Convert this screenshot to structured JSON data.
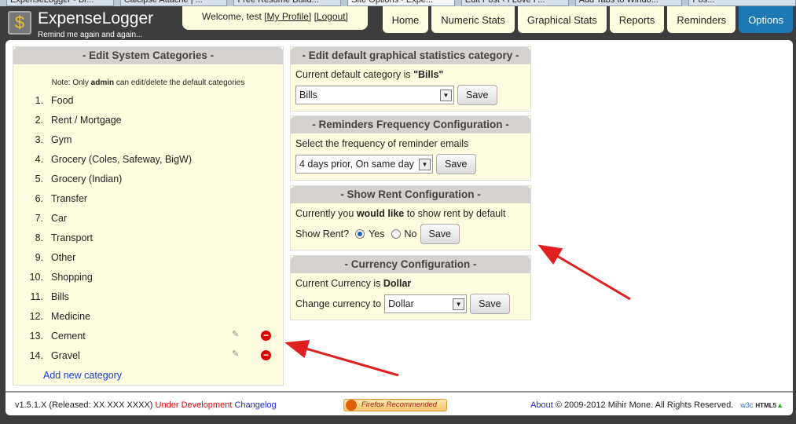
{
  "browser_tabs": [
    "ExpenseLogger - Br...",
    "Calcipse Attache | ...",
    "Free Resume Build...",
    "Site Options - Expe...",
    "Edit Post ‹ I Love F...",
    "Add Tabs to Windo...",
    "Pos..."
  ],
  "header": {
    "title": "ExpenseLogger",
    "tagline": "Remind me again and again...",
    "welcome": "Welcome, test",
    "my_profile": "[My Profile]",
    "logout": "[Logout]"
  },
  "nav": [
    "Home",
    "Numeric Stats",
    "Graphical Stats",
    "Reports",
    "Reminders",
    "Options"
  ],
  "categories_panel": {
    "title": "- Edit System Categories -",
    "note_pre": "Note: Only ",
    "note_bold": "admin",
    "note_post": " can edit/delete the default categories",
    "items": [
      "Food",
      "Rent / Mortgage",
      "Gym",
      "Grocery (Coles, Safeway, BigW)",
      "Grocery (Indian)",
      "Transfer",
      "Car",
      "Transport",
      "Other",
      "Shopping",
      "Bills",
      "Medicine",
      "Cement",
      "Gravel"
    ],
    "add_label": "Add new category"
  },
  "graph_panel": {
    "title": "- Edit default graphical statistics category -",
    "text": "Current default category is ",
    "value": "\"Bills\"",
    "select": "Bills",
    "save": "Save"
  },
  "reminder_panel": {
    "title": "- Reminders Frequency Configuration -",
    "text": "Select the frequency of reminder emails",
    "select": "4 days prior, On same day",
    "save": "Save"
  },
  "rent_panel": {
    "title": "- Show Rent Configuration -",
    "text_pre": "Currently you ",
    "text_bold": "would like",
    "text_post": " to show rent by default",
    "label": "Show Rent?",
    "yes": "Yes",
    "no": "No",
    "selected": "Yes",
    "save": "Save"
  },
  "currency_panel": {
    "title": "- Currency Configuration -",
    "text": "Current Currency is ",
    "value": "Dollar",
    "label": "Change currency to",
    "select": "Dollar",
    "save": "Save"
  },
  "footer": {
    "version": "v1.5.1.X (Released: XX XXX XXXX)",
    "dev": "Under Development",
    "changelog": "Changelog",
    "firefox": "Firefox Recommended",
    "about": "About",
    "copyright": "© 2009-2012 Mihir Mone. All Rights Reserved.",
    "w3c": "w3c",
    "html5": "HTML5"
  }
}
